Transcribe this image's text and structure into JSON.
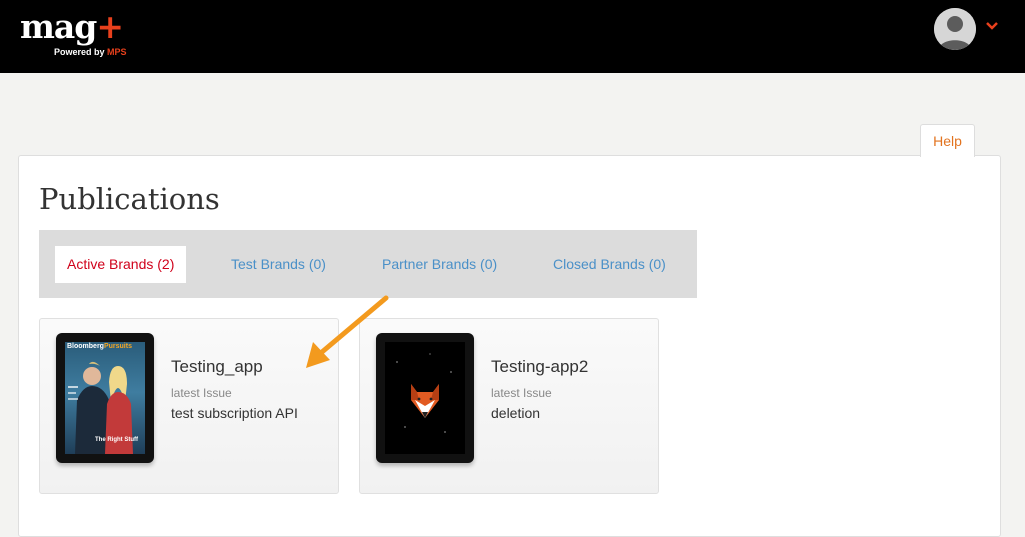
{
  "header": {
    "logo_text": "mag",
    "logo_plus": "+",
    "powered_by": "Powered by",
    "powered_brand": "MPS"
  },
  "help_label": "Help",
  "page_title": "Publications",
  "tabs": [
    {
      "label": "Active Brands (2)",
      "active": true
    },
    {
      "label": "Test Brands (0)",
      "active": false
    },
    {
      "label": "Partner Brands (0)",
      "active": false
    },
    {
      "label": "Closed Brands (0)",
      "active": false
    }
  ],
  "publications": [
    {
      "name": "Testing_app",
      "latest_label": "latest Issue",
      "issue": "test subscription API",
      "cover": {
        "title": "Bloomberg",
        "subtitle": "Pursuits",
        "caption": "The Right Stuff"
      }
    },
    {
      "name": "Testing-app2",
      "latest_label": "latest Issue",
      "issue": "deletion"
    }
  ],
  "colors": {
    "topbar": "#000000",
    "brand_accent": "#e8401c",
    "active_tab_text": "#d0021b",
    "tab_text": "#4a90c8",
    "help_text": "#e2731f",
    "arrow": "#f39a1e"
  },
  "icons": [
    "user-avatar-icon",
    "chevron-down-icon",
    "fox-logo-icon",
    "arrow-annotation-icon"
  ]
}
